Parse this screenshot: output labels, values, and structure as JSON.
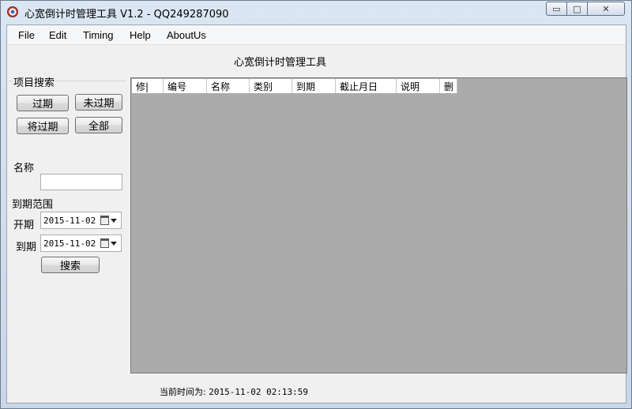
{
  "window": {
    "title": "心宽倒计时管理工具 V1.2 - QQ249287090",
    "controls": {
      "minimize": "▭",
      "maximize": "□",
      "close": "✕"
    }
  },
  "menu": [
    "File",
    "Edit",
    "Timing",
    "Help",
    "AboutUs"
  ],
  "app_title": "心宽倒计时管理工具",
  "search": {
    "group_label": "项目搜索",
    "buttons": {
      "expired": "过期",
      "not_expired": "未过期",
      "expiring": "将过期",
      "all": "全部"
    },
    "name_label": "名称",
    "name_value": "",
    "range_label": "到期范围",
    "start_label": "开期",
    "start_date": "2015-11-02",
    "end_label": "到期",
    "end_date": "2015-11-02",
    "search_button": "搜索"
  },
  "grid": {
    "columns": [
      "修|",
      "编号",
      "名称",
      "类别",
      "到期",
      "截止月日",
      "说明",
      "删"
    ]
  },
  "status": {
    "label": "当前时间为:",
    "time": "2015-11-02 02:13:59"
  },
  "colors": {
    "grid_background": "#ababab",
    "client_background": "#f0f0f0"
  }
}
